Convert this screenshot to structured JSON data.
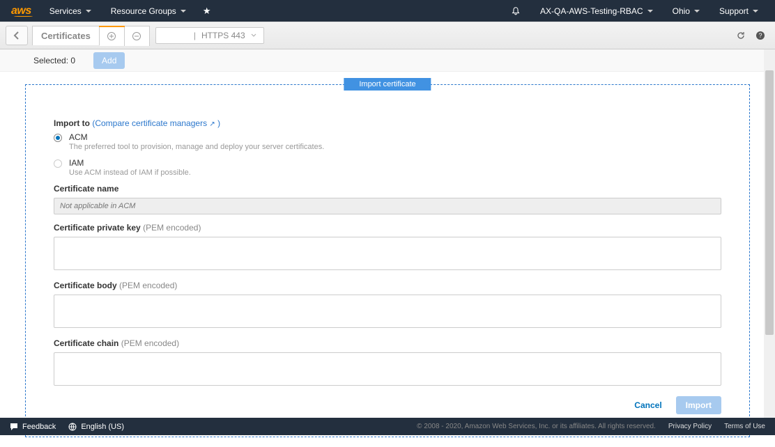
{
  "topnav": {
    "logo": "aws",
    "services": "Services",
    "resource_groups": "Resource Groups",
    "account": "AX-QA-AWS-Testing-RBAC",
    "region": "Ohio",
    "support": "Support"
  },
  "subbar": {
    "title": "Certificates",
    "listener_label": "HTTPS 443"
  },
  "selbar": {
    "selected_text": "Selected: 0",
    "add": "Add"
  },
  "form": {
    "box_title": "Import certificate",
    "import_to_label": "Import to",
    "compare_link": "Compare certificate managers",
    "options": {
      "acm": {
        "title": "ACM",
        "desc": "The preferred tool to provision, manage and deploy your server certificates."
      },
      "iam": {
        "title": "IAM",
        "desc": "Use ACM instead of IAM if possible."
      }
    },
    "cert_name_label": "Certificate name",
    "cert_name_placeholder": "Not applicable in ACM",
    "priv_key_label": "Certificate private key",
    "body_label": "Certificate body",
    "chain_label": "Certificate chain",
    "pem_hint": "(PEM encoded)",
    "cancel": "Cancel",
    "import": "Import"
  },
  "footer": {
    "feedback": "Feedback",
    "language": "English (US)",
    "copyright": "© 2008 - 2020, Amazon Web Services, Inc. or its affiliates. All rights reserved.",
    "privacy": "Privacy Policy",
    "terms": "Terms of Use"
  }
}
